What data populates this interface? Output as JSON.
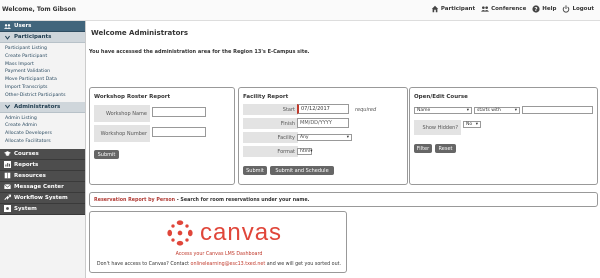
{
  "header": {
    "welcome": "Welcome, Tom Gibson",
    "nav": [
      {
        "label": "Participant",
        "icon": "home-icon"
      },
      {
        "label": "Conference",
        "icon": "people-icon"
      },
      {
        "label": "Help",
        "icon": "help-icon"
      },
      {
        "label": "Logout",
        "icon": "power-icon"
      }
    ]
  },
  "sidebar": {
    "users": "Users",
    "participants": {
      "title": "Participants",
      "items": [
        "Participant Listing",
        "Create Participant",
        "Mass Import",
        "Payment Validation",
        "Move Participant Data",
        "Import Transcripts",
        "Other-District Participants"
      ]
    },
    "administrators": {
      "title": "Administrators",
      "items": [
        "Admin Listing",
        "Create Admin",
        "Allocate Developers",
        "Allocate Facilitators"
      ]
    },
    "sections": [
      "Courses",
      "Reports",
      "Resources",
      "Message Center",
      "Workflow System",
      "System"
    ]
  },
  "main": {
    "title": "Welcome Administrators",
    "intro": "You have accessed the administration area for the Region 13's E-Campus site.",
    "roster": {
      "title": "Workshop Roster Report",
      "name_label": "Workshop Name",
      "number_label": "Workshop Number",
      "submit": "Submit"
    },
    "facility": {
      "title": "Facility Report",
      "start_label": "Start",
      "start_value": "07/12/2017",
      "required": "required",
      "finish_label": "Finish",
      "finish_placeholder": "MM/DD/YYYY",
      "facility_label": "Facility",
      "facility_value": "Any",
      "format_label": "Format",
      "format_value": "html",
      "submit": "Submit",
      "submit_schedule": "Submit and Schedule"
    },
    "course": {
      "title": "Open/Edit Course",
      "field_value": "Name",
      "operator_value": "starts with",
      "hidden_label": "Show Hidden?",
      "hidden_value": "No",
      "filter": "Filter",
      "reset": "Reset"
    },
    "reservation": {
      "link": "Reservation Report by Person",
      "rest": " - Search for room reservations under your name."
    },
    "canvas": {
      "logo": "canvas",
      "access": "Access your Canvas LMS Dashboard",
      "help_pre": "Don't have access to Canvas? Contact ",
      "email": "onlinelearning@esc13.txed.net",
      "help_post": " and we will get you sorted out."
    }
  },
  "colors": {
    "accent_red": "#e0463a",
    "sidebar_blue": "#41657c",
    "sidebar_dark": "#4d4d4d"
  }
}
